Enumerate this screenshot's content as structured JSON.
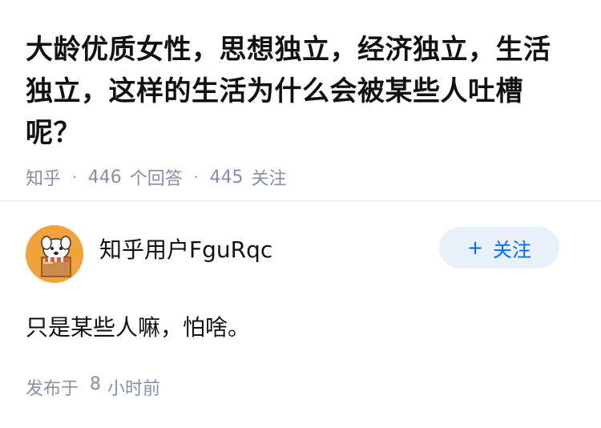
{
  "question": {
    "title": "大龄优质女性，思想独立，经济独立，生活独立，这样的生活为什么会被某些人吐槽呢？",
    "source": "知乎",
    "answer_count": "446",
    "answer_label": "个回答",
    "follower_count": "445",
    "follower_label": "关注",
    "separator": "·"
  },
  "answer": {
    "author_name": "知乎用户FguRqc",
    "follow_button": {
      "plus": "+",
      "label": "关注"
    },
    "content": "只是某些人嘛，怕啥。",
    "time_prefix": "发布于",
    "time_value": "8",
    "time_unit": "小时前"
  },
  "colors": {
    "accent": "#0066ff",
    "follow_bg": "#e8f0fa",
    "meta_text": "#8590a6",
    "avatar_bg": "#f2a23a"
  },
  "icons": {
    "avatar": "dog-avatar-icon"
  }
}
